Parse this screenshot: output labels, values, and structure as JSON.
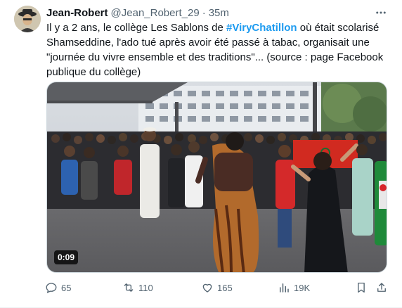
{
  "author": {
    "name": "Jean-Robert",
    "handle": "@Jean_Robert_29",
    "separator": "·",
    "time": "35m"
  },
  "tweet": {
    "text_before": "Il y a 2 ans, le collège Les Sablons de ",
    "hashtag": "#ViryChatillon",
    "text_after": " où était scolarisé Shamseddine, l'ado tué après avoir été passé à tabac, organisait une \"journée du vivre ensemble et des traditions\"... (source : page Facebook publique du collège)"
  },
  "video": {
    "duration": "0:09"
  },
  "actions": {
    "replies": "65",
    "retweets": "110",
    "likes": "165",
    "views": "19K"
  },
  "colors": {
    "accent": "#1d9bf0",
    "secondary_text": "#536471",
    "primary_text": "#0f1419"
  },
  "icons": [
    "more-icon",
    "reply-icon",
    "retweet-icon",
    "like-icon",
    "views-icon",
    "bookmark-icon",
    "share-icon"
  ]
}
